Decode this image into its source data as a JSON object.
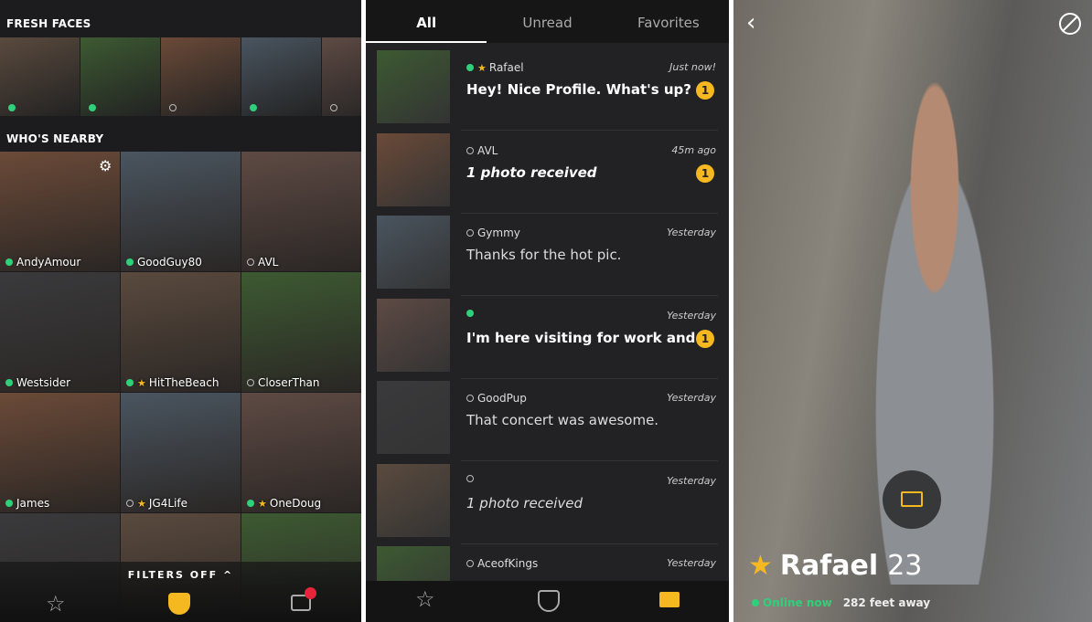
{
  "grid": {
    "fresh_title": "FRESH FACES",
    "nearby_title": "WHO'S NEARBY",
    "filters": "FILTERS OFF",
    "fresh": [
      {
        "online": true
      },
      {
        "online": true
      },
      {
        "online": false
      },
      {
        "online": true
      },
      {
        "online": false
      }
    ],
    "nearby": [
      {
        "name": "AndyAmour",
        "online": true,
        "fav": false
      },
      {
        "name": "GoodGuy80",
        "online": true,
        "fav": false
      },
      {
        "name": "AVL",
        "online": false,
        "fav": false
      },
      {
        "name": "Westsider",
        "online": true,
        "fav": false
      },
      {
        "name": "HitTheBeach",
        "online": true,
        "fav": true
      },
      {
        "name": "CloserThan",
        "online": false,
        "fav": false
      },
      {
        "name": "James",
        "online": true,
        "fav": false
      },
      {
        "name": "JG4Life",
        "online": false,
        "fav": true
      },
      {
        "name": "OneDoug",
        "online": true,
        "fav": true
      },
      {
        "name": "",
        "online": false,
        "fav": false
      },
      {
        "name": "",
        "online": false,
        "fav": false
      },
      {
        "name": "",
        "online": false,
        "fav": false
      }
    ]
  },
  "inbox": {
    "tabs": [
      "All",
      "Unread",
      "Favorites"
    ],
    "rows": [
      {
        "name": "Rafael",
        "online": true,
        "fav": true,
        "time": "Just now!",
        "msg": "Hey! Nice Profile. What's up?",
        "style": "b",
        "unread": "1"
      },
      {
        "name": "AVL",
        "online": false,
        "fav": false,
        "time": "45m ago",
        "msg": "1 photo received",
        "style": "b i",
        "unread": "1"
      },
      {
        "name": "Gymmy",
        "online": false,
        "fav": false,
        "time": "Yesterday",
        "msg": "Thanks for the hot pic.",
        "style": "",
        "unread": ""
      },
      {
        "name": "",
        "online": true,
        "fav": false,
        "time": "Yesterday",
        "msg": "I'm here visiting for work and...",
        "style": "b",
        "unread": "1"
      },
      {
        "name": "GoodPup",
        "online": false,
        "fav": false,
        "time": "Yesterday",
        "msg": "That concert was awesome.",
        "style": "",
        "unread": ""
      },
      {
        "name": "",
        "online": false,
        "fav": false,
        "time": "Yesterday",
        "msg": "1 photo received",
        "style": "i",
        "unread": ""
      },
      {
        "name": "AceofKings",
        "online": false,
        "fav": false,
        "time": "Yesterday",
        "msg": "",
        "style": "",
        "unread": ""
      }
    ]
  },
  "profile": {
    "name": "Rafael",
    "age": "23",
    "status": "Online now",
    "distance": "282 feet away"
  },
  "colors": {
    "accent": "#f6b820",
    "online": "#2fd07a",
    "notification": "#e8243c"
  }
}
